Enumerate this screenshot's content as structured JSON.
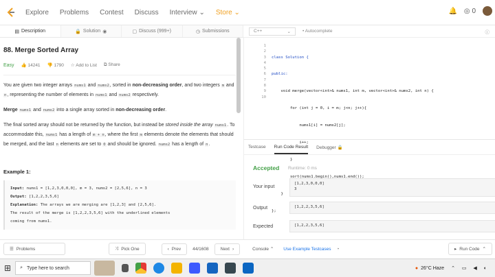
{
  "topnav": {
    "items": [
      "Explore",
      "Problems",
      "Contest",
      "Discuss",
      "Interview",
      "Store"
    ],
    "notification_count": "0"
  },
  "tabs": {
    "description": "Description",
    "solution": "Solution",
    "discuss": "Discuss (999+)",
    "submissions": "Submissions"
  },
  "problem": {
    "title": "88. Merge Sorted Array",
    "difficulty": "Easy",
    "likes": "14241",
    "dislikes": "1790",
    "add_to_list": "Add to List",
    "share": "Share",
    "p1_a": "You are given two integer arrays ",
    "p1_nums1": "nums1",
    "p1_b": " and ",
    "p1_nums2": "nums2",
    "p1_c": ", sorted in ",
    "p1_bold": "non-decreasing order",
    "p1_d": ", and two integers ",
    "p1_m": "m",
    "p1_e": " and ",
    "p1_n": "n",
    "p1_f": ", representing the number of elements in ",
    "p1_nums1b": "nums1",
    "p1_g": " and ",
    "p1_nums2b": "nums2",
    "p1_h": " respectively.",
    "p2_a": "Merge ",
    "p2_nums1": "nums1",
    "p2_b": " and ",
    "p2_nums2": "nums2",
    "p2_c": " into a single array sorted in ",
    "p2_bold": "non-decreasing order",
    "p2_d": ".",
    "p3_a": "The final sorted array should not be returned by the function, but instead be ",
    "p3_em": "stored inside the array",
    "p3_nums1": "nums1",
    "p3_b": ". To accommodate this, ",
    "p3_nums1b": "nums1",
    "p3_c": " has a length of ",
    "p3_mn": "m + n",
    "p3_d": ", where the first ",
    "p3_m": "m",
    "p3_e": " elements denote the elements that should be merged, and the last ",
    "p3_n": "n",
    "p3_f": " elements are set to ",
    "p3_zero": "0",
    "p3_g": " and should be ignored. ",
    "p3_nums2": "nums2",
    "p3_h": " has a length of ",
    "p3_n2": "n",
    "p3_i": ".",
    "example_heading": "Example 1:",
    "ex_input_label": "Input:",
    "ex_input": " nums1 = [1,2,3,0,0,0], m = 3, nums2 = [2,5,6], n = 3",
    "ex_output_label": "Output:",
    "ex_output": " [1,2,2,3,5,6]",
    "ex_expl_label": "Explanation:",
    "ex_expl": " The arrays we are merging are [1,2,3] and [2,5,6].",
    "ex_result": "The result of the merge is [1,2,2,3,5,6] with the underlined elements",
    "ex_result2": "coming from nums1."
  },
  "editor": {
    "language": "C++",
    "autocomplete": "Autocomplete",
    "line_numbers": [
      "1",
      "2",
      "3",
      "4",
      "5",
      "6",
      "7",
      "8",
      "9",
      "10"
    ],
    "lines": [
      "class Solution {",
      "public:",
      "    void merge(vector<int>& nums1, int m, vector<int>& nums2, int n) {",
      "        for (int j = 0, i = m; j<n; j++){",
      "            nums1[i] = nums2[j];",
      "            i++;",
      "        }",
      "        sort(nums1.begin(),nums1.end());",
      "    }",
      "};"
    ]
  },
  "result_panel": {
    "tabs": [
      "Testcase",
      "Run Code Result",
      "Debugger"
    ],
    "status": "Accepted",
    "runtime": "Runtime: 0 ms",
    "your_input_label": "Your input",
    "your_input": "[1,2,3,0,0,0]\n3",
    "output_label": "Output",
    "output": "[1,2,2,3,5,6]",
    "expected_label": "Expected",
    "expected": "[1,2,2,3,5,6]"
  },
  "footer": {
    "problems": "Problems",
    "pick_one": "Pick One",
    "prev": "Prev",
    "page": "44/1608",
    "next": "Next",
    "console": "Console",
    "use_example": "Use Example Testcases",
    "run_code": "Run Code"
  },
  "taskbar": {
    "search_placeholder": "Type here to search",
    "weather": "26°C  Haze"
  },
  "colors": {
    "accent_green": "#43a047",
    "store_orange": "#f0a020",
    "link_blue": "#1a73e8"
  }
}
